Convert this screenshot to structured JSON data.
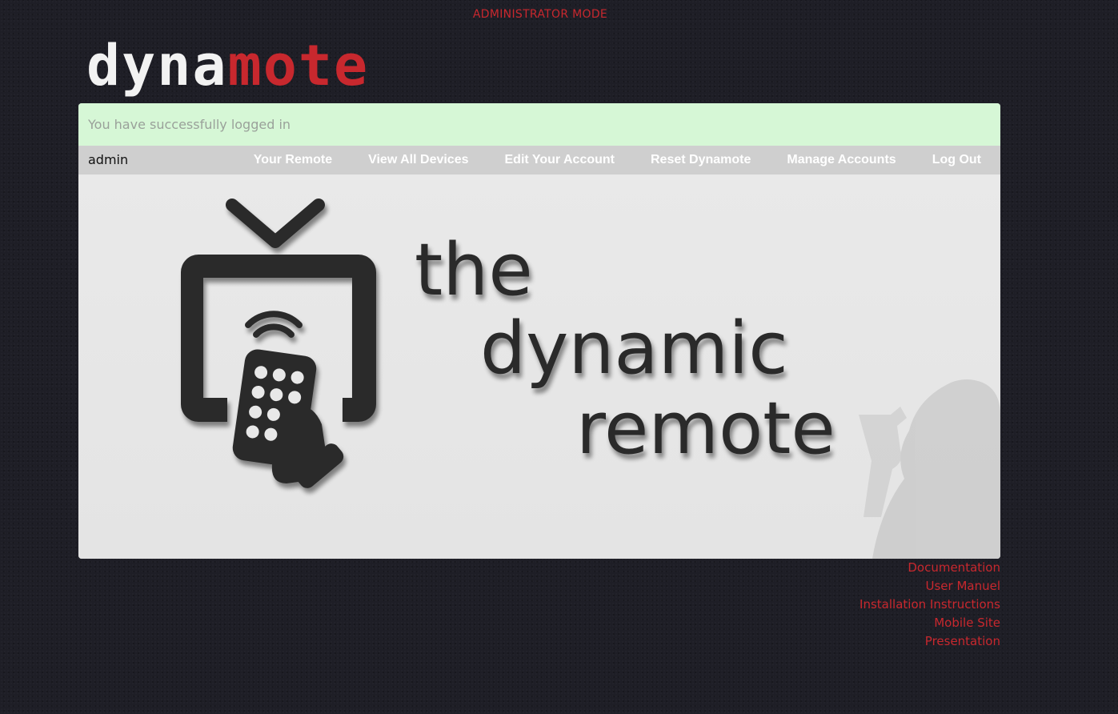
{
  "banner": {
    "mode": "ADMINISTRATOR MODE"
  },
  "logo": {
    "part1": "dyna",
    "part2": "mote"
  },
  "alert": {
    "message": "You have successfully logged in"
  },
  "navbar": {
    "user": "admin",
    "links": [
      {
        "label": "Your Remote"
      },
      {
        "label": "View All Devices"
      },
      {
        "label": "Edit Your Account"
      },
      {
        "label": "Reset Dynamote"
      },
      {
        "label": "Manage Accounts"
      },
      {
        "label": "Log Out"
      }
    ]
  },
  "hero": {
    "line1": "the",
    "line2": "dynamic",
    "line3": "remote"
  },
  "footer": {
    "links": [
      {
        "label": "Documentation"
      },
      {
        "label": "User Manuel"
      },
      {
        "label": "Installation Instructions"
      },
      {
        "label": "Mobile Site"
      },
      {
        "label": "Presentation"
      }
    ]
  },
  "colors": {
    "accent": "#c8282e",
    "background": "#1e1e26",
    "alert_bg": "#d6f7d6",
    "nav_bg": "#cfcfcf"
  }
}
